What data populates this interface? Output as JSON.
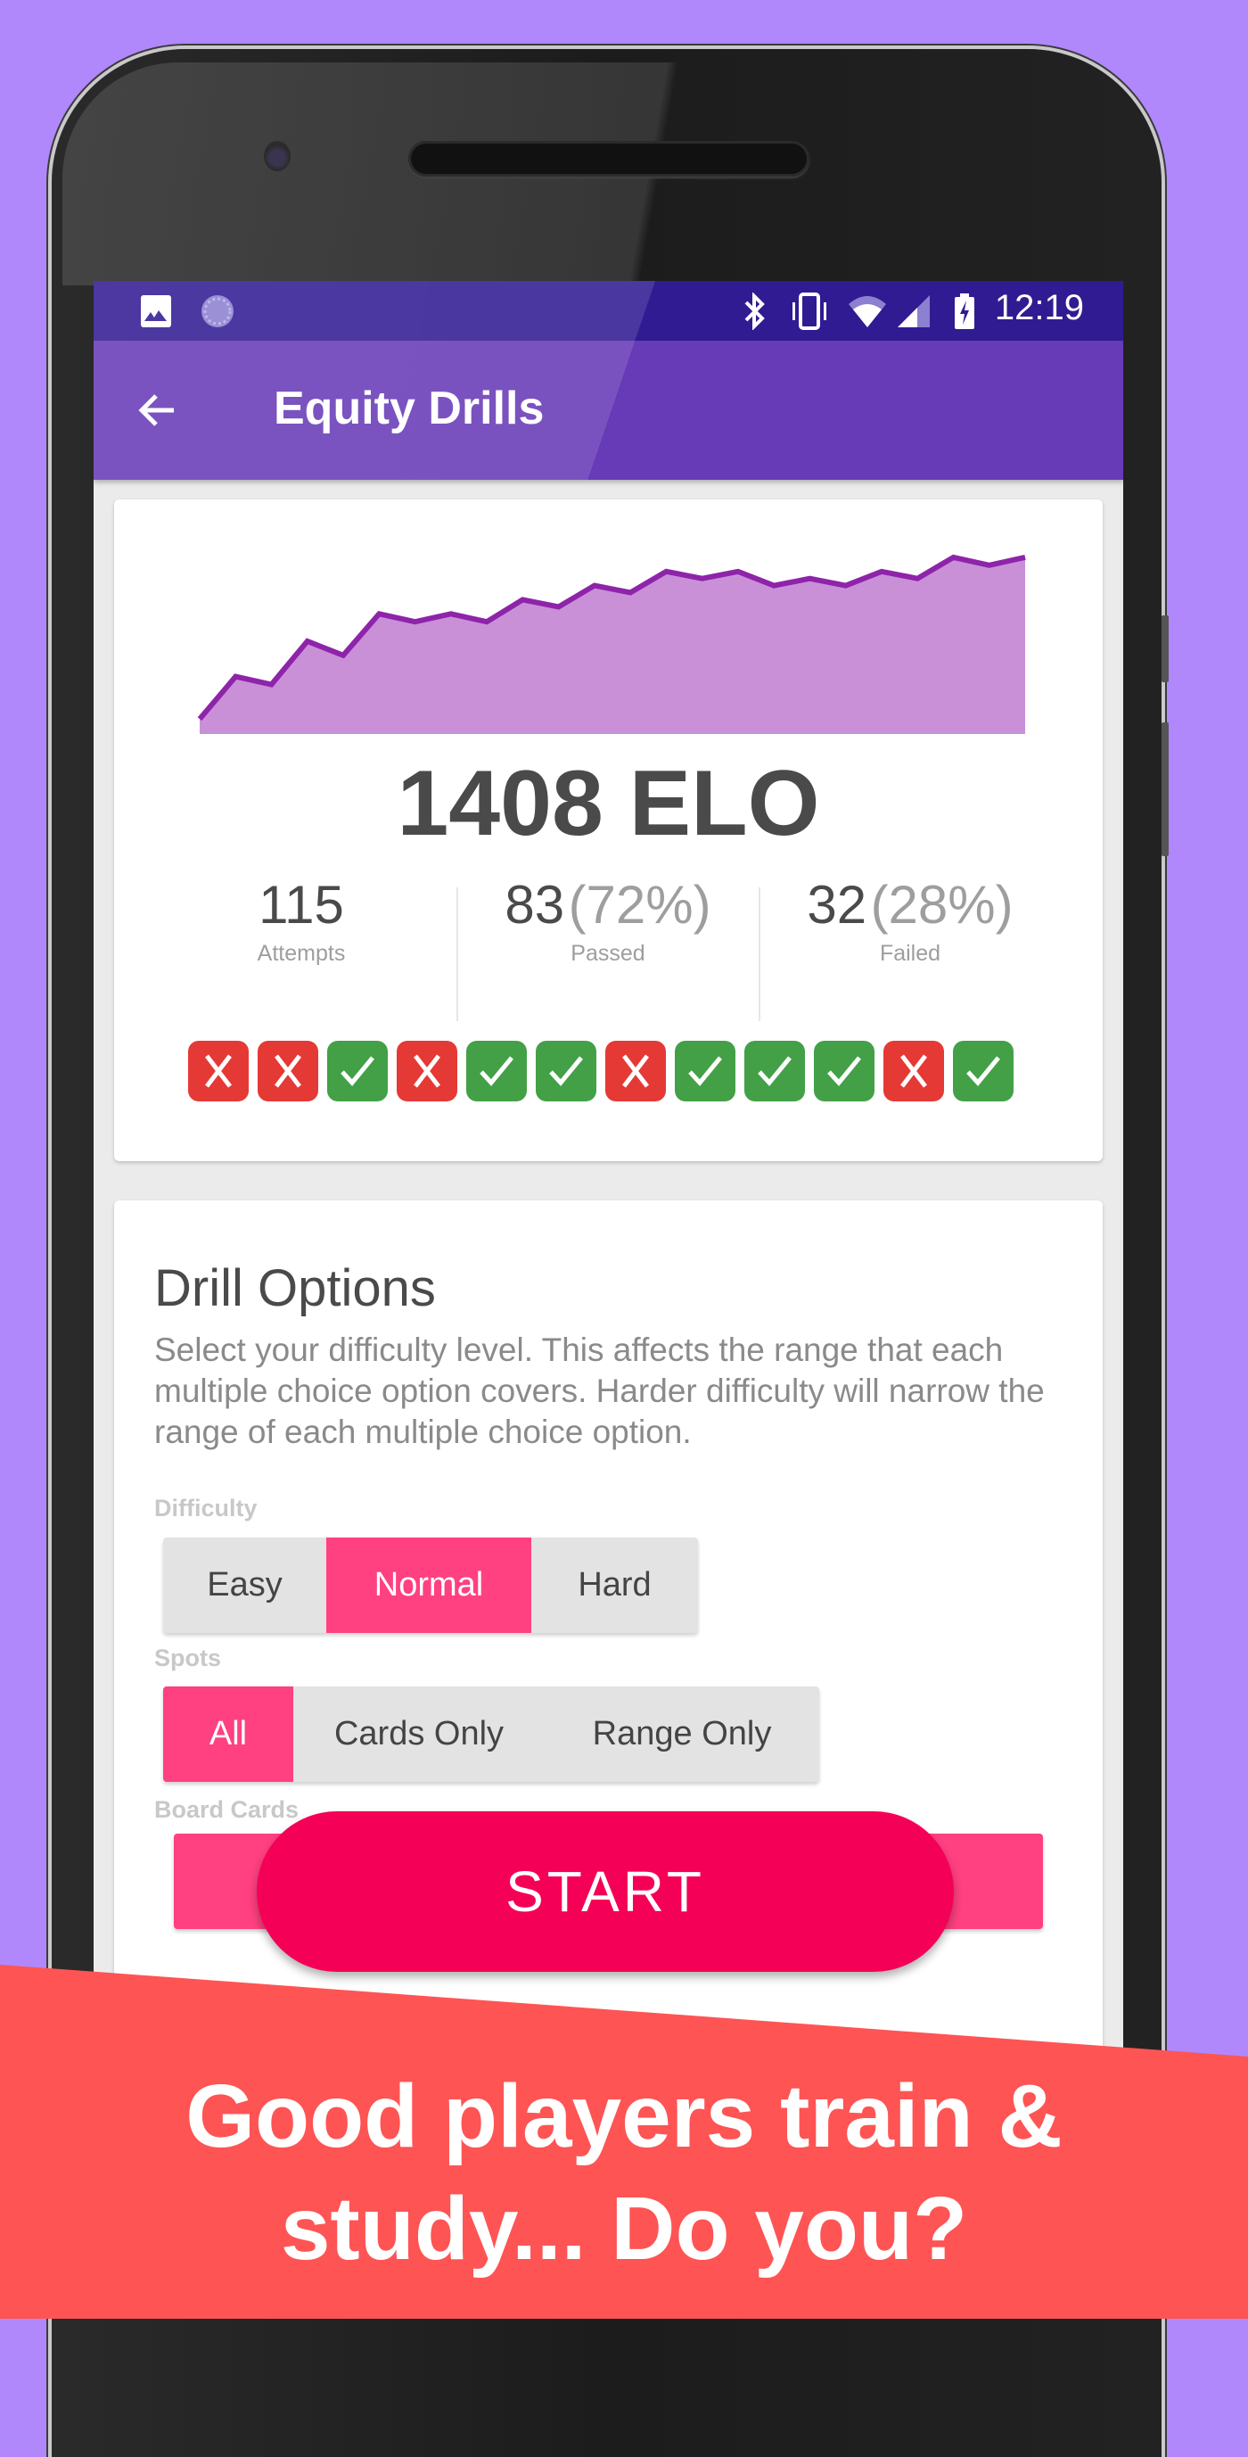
{
  "statusbar": {
    "left_icons": [
      "image-icon",
      "sync-icon"
    ],
    "right_icons": [
      "bluetooth-icon",
      "vibrate-icon",
      "wifi-icon",
      "signal-icon",
      "battery-charging-icon"
    ],
    "time": "12:19"
  },
  "toolbar": {
    "back_icon": "arrow-left-icon",
    "title": "Equity Drills"
  },
  "colors": {
    "background": "#b088fc",
    "statusbar": "#311b92",
    "toolbar": "#673ab7",
    "accent": "#ff4081",
    "start_button": "#f50057",
    "chart_line": "#8e24aa",
    "chart_fill": "#c990d8",
    "pass": "#43a047",
    "fail": "#e53935",
    "promo": "#fe5454"
  },
  "chart_data": {
    "type": "area",
    "title": "",
    "xlabel": "",
    "ylabel": "",
    "description": "ELO progression sparkline (unlabeled axes, relative values)",
    "x": [
      0,
      1,
      2,
      3,
      4,
      5,
      6,
      7,
      8,
      9,
      10,
      11,
      12,
      13,
      14,
      15,
      16,
      17,
      18,
      19,
      20,
      21,
      22,
      23
    ],
    "values": [
      17,
      65,
      56,
      105,
      89,
      136,
      127,
      136,
      127,
      152,
      144,
      168,
      160,
      184,
      176,
      184,
      168,
      176,
      168,
      184,
      176,
      200,
      191,
      200
    ],
    "ylim": [
      0,
      210
    ],
    "grid": false,
    "legend": "none"
  },
  "stats": {
    "elo": "1408 ELO",
    "attempts": {
      "value": "115",
      "label": "Attempts"
    },
    "passed": {
      "value": "83",
      "percent": "(72%)",
      "label": "Passed"
    },
    "failed": {
      "value": "32",
      "percent": "(28%)",
      "label": "Failed"
    }
  },
  "recent_results": [
    "fail",
    "fail",
    "pass",
    "fail",
    "pass",
    "pass",
    "fail",
    "pass",
    "pass",
    "pass",
    "fail",
    "pass"
  ],
  "drill_options": {
    "title": "Drill Options",
    "description": "Select your difficulty level. This affects the range that each multiple choice option covers. Harder difficulty will narrow the range of each multiple choice option.",
    "difficulty": {
      "label": "Difficulty",
      "options": [
        "Easy",
        "Normal",
        "Hard"
      ],
      "selected": "Normal"
    },
    "spots": {
      "label": "Spots",
      "options": [
        "All",
        "Cards Only",
        "Range Only"
      ],
      "selected": "All"
    },
    "board_cards": {
      "label": "Board Cards"
    },
    "start_label": "START"
  },
  "promo": {
    "line1": "Good players train &",
    "line2": "study... Do you?"
  }
}
